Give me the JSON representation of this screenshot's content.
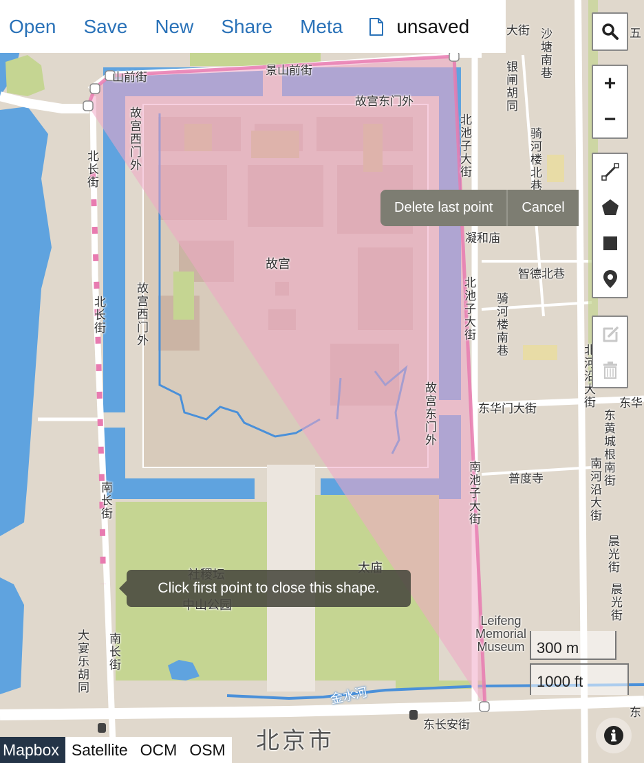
{
  "toolbar": {
    "open_label": "Open",
    "save_label": "Save",
    "new_label": "New",
    "share_label": "Share",
    "meta_label": "Meta",
    "file_icon": "file-icon",
    "file_name": "unsaved"
  },
  "controls": {
    "search_icon": "search-icon",
    "zoom_in_label": "+",
    "zoom_out_label": "−",
    "draw_tools": [
      "polyline-icon",
      "polygon-icon",
      "rectangle-icon",
      "marker-icon"
    ],
    "edit_tools": [
      "edit-icon",
      "trash-icon"
    ]
  },
  "draw_actions": {
    "delete_last_point": "Delete last point",
    "cancel": "Cancel"
  },
  "tooltip": {
    "text": "Click first point to close this shape."
  },
  "layers": {
    "items": [
      "Mapbox",
      "Satellite",
      "OCM",
      "OSM"
    ],
    "active": "Mapbox"
  },
  "scale": {
    "metric": "300 m",
    "imperial": "1000 ft"
  },
  "map": {
    "colors": {
      "land": "#e0d8cc",
      "water": "#5fa3df",
      "park": "#c5d592",
      "road": "#ffffff",
      "drawing_fill": "#f0a7c6",
      "drawing_stroke": "#e87bb0"
    },
    "labels": {
      "jingshan_qianjie_left": "山前街",
      "jingshan_qianjie": "景山前街",
      "gugong_dongmenwai_top": "故宫东门外",
      "gugong_ximenwai_top": "故宫西门外",
      "gugong_ximenwai_mid": "故宫西门外",
      "gugong_dongmenwai_bottom": "故宫东门外",
      "beichang_jie_top": "北长街",
      "beichang_jie_mid": "北长街",
      "nanchang_jie_top": "南长街",
      "nanchang_jie_bottom": "南长街",
      "beichizi_top": "北池子大街",
      "beichizi_mid": "北池子大街",
      "nanchizi": "南池子大街",
      "gugong": "故宫",
      "ninghe_miao": "凝和庙",
      "zhide_beixiang": "智德北巷",
      "qihe_lounanxiang": "骑河楼南巷",
      "qihe_loubeixiang": "骑河楼北巷",
      "yinzha_hutong": "银闸胡同",
      "shatang_nanxiang": "沙塘南巷",
      "da_jie_top": "大街",
      "donghuamen_dajie": "东华门大街",
      "dong_hua": "东华",
      "puduo_si": "普度寺",
      "beiheyan_dajie": "北河沿大街",
      "nanheyan_dajie": "南河沿大街",
      "donghuangchenggen_nanjie": "东黄城根南街",
      "chenguang_jie_1": "晨光街",
      "chenguang_jie_2": "晨光街",
      "sheji_tan": "社稷坛",
      "zhongshan_gongyuan": "中山公园",
      "tai_miao": "太庙",
      "leifeng": "Leifeng Memorial Museum",
      "jinshui_he": "金水河",
      "dayanle_hutong": "大宴乐胡同",
      "dongchangan_jie": "东长安街",
      "beijing_shi": "北京市",
      "dong_right": "东",
      "wu_top_right": "五"
    }
  }
}
